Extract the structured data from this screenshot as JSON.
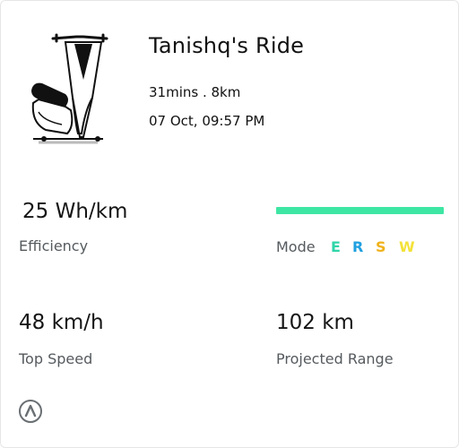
{
  "ride": {
    "title": "Tanishq's Ride",
    "duration": "31mins . 8km",
    "datetime": "07 Oct, 09:57 PM"
  },
  "stats": {
    "efficiency": {
      "value": "25 Wh/km",
      "label": "Efficiency"
    },
    "top_speed": {
      "value": "48 km/h",
      "label": "Top Speed"
    },
    "projected_range": {
      "value": "102 km",
      "label": "Projected Range"
    }
  },
  "mode": {
    "label": "Mode",
    "bar_color": "#3ee6a3",
    "letters": [
      {
        "text": "E",
        "color": "#2fd5a8"
      },
      {
        "text": "R",
        "color": "#1fa0e0"
      },
      {
        "text": "S",
        "color": "#f0b21a"
      },
      {
        "text": "W",
        "color": "#f3e23a"
      }
    ]
  },
  "icons": {
    "scooter": "scooter-illustration",
    "brand": "brand-logo-icon"
  }
}
